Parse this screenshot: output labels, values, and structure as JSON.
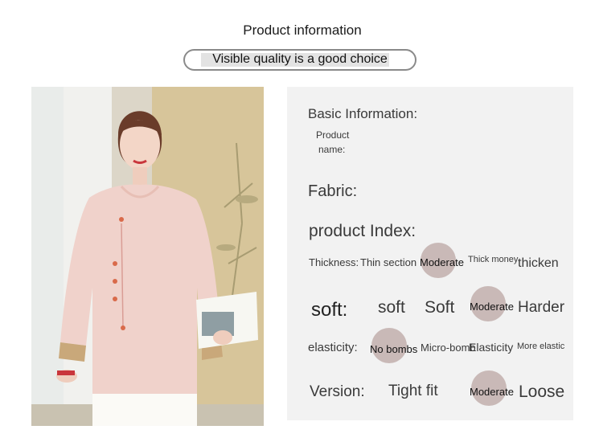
{
  "header": {
    "title": "Product information",
    "slogan": "Visible quality is a good choice"
  },
  "panel": {
    "basic_info_label": "Basic Information:",
    "product_name_label_1": "Product",
    "product_name_label_2": "name:",
    "fabric_label": "Fabric:",
    "index_label": "product Index:",
    "thickness": {
      "label": "Thickness:",
      "options": [
        "Thin section",
        "Moderate",
        "Thick money",
        "thicken"
      ],
      "selected": "Moderate"
    },
    "softness": {
      "label": "soft:",
      "options": [
        "soft",
        "Soft",
        "Moderate",
        "Harder"
      ],
      "selected": "Moderate"
    },
    "elasticity": {
      "label": "elasticity:",
      "options": [
        "No bombs",
        "Micro-bomb",
        "Elasticity",
        "More elastic"
      ],
      "selected": "No bombs"
    },
    "version": {
      "label": "Version:",
      "options": [
        "Tight fit",
        "Moderate",
        "Loose"
      ],
      "selected": "Moderate"
    }
  },
  "colors": {
    "marker": "#c9b9b7",
    "panel_bg": "#f2f2f2",
    "blouse": "#f0d2cb"
  }
}
